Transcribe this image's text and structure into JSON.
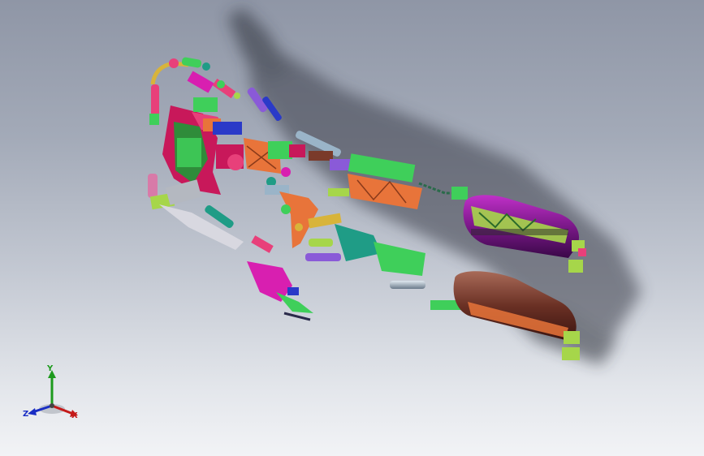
{
  "viewport": {
    "background_top": "#8f96a6",
    "background_bottom": "#f2f3f6"
  },
  "model": {
    "palette": {
      "magenta": "#d81fb0",
      "pink": "#e8407a",
      "green": "#3fcf5a",
      "lime": "#a6d64a",
      "teal": "#1f9c86",
      "orange": "#e8743a",
      "purple": "#8a1f9c",
      "brown": "#7a3a2a",
      "blue": "#2a3ac8",
      "steel": "#9ab4c8",
      "yellow": "#d8b43a",
      "violet": "#8a5ad8"
    }
  },
  "triad": {
    "x_label": "X",
    "y_label": "Y",
    "z_label": "Z",
    "x_color": "#c41a1a",
    "y_color": "#1d9a1d",
    "z_color": "#1a2ec4"
  }
}
